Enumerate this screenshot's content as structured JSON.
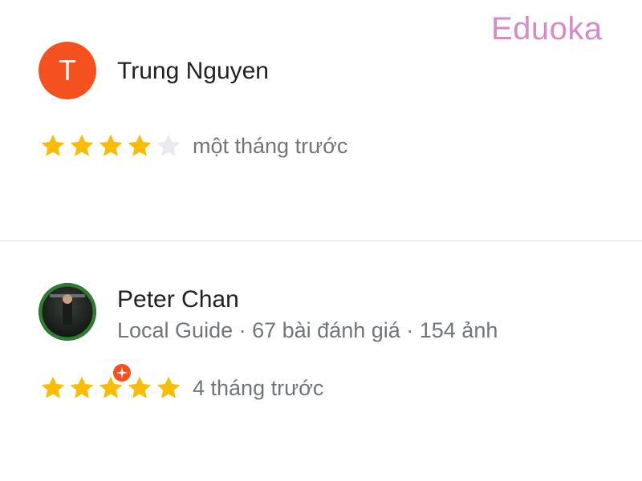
{
  "brand": {
    "logo_text": "Eduoka"
  },
  "colors": {
    "star_filled": "#fbbc04",
    "star_empty": "#e8eaed",
    "avatar_t": "#f4511e",
    "logo": "#d889c6"
  },
  "reviews": [
    {
      "avatar_letter": "T",
      "name": "Trung Nguyen",
      "meta": "",
      "rating": 4,
      "max_rating": 5,
      "time": "một tháng trước"
    },
    {
      "avatar_letter": "",
      "name": "Peter Chan",
      "meta": "Local Guide · 67 bài đánh giá · 154 ảnh",
      "rating": 5,
      "max_rating": 5,
      "time": "4 tháng trước"
    }
  ]
}
